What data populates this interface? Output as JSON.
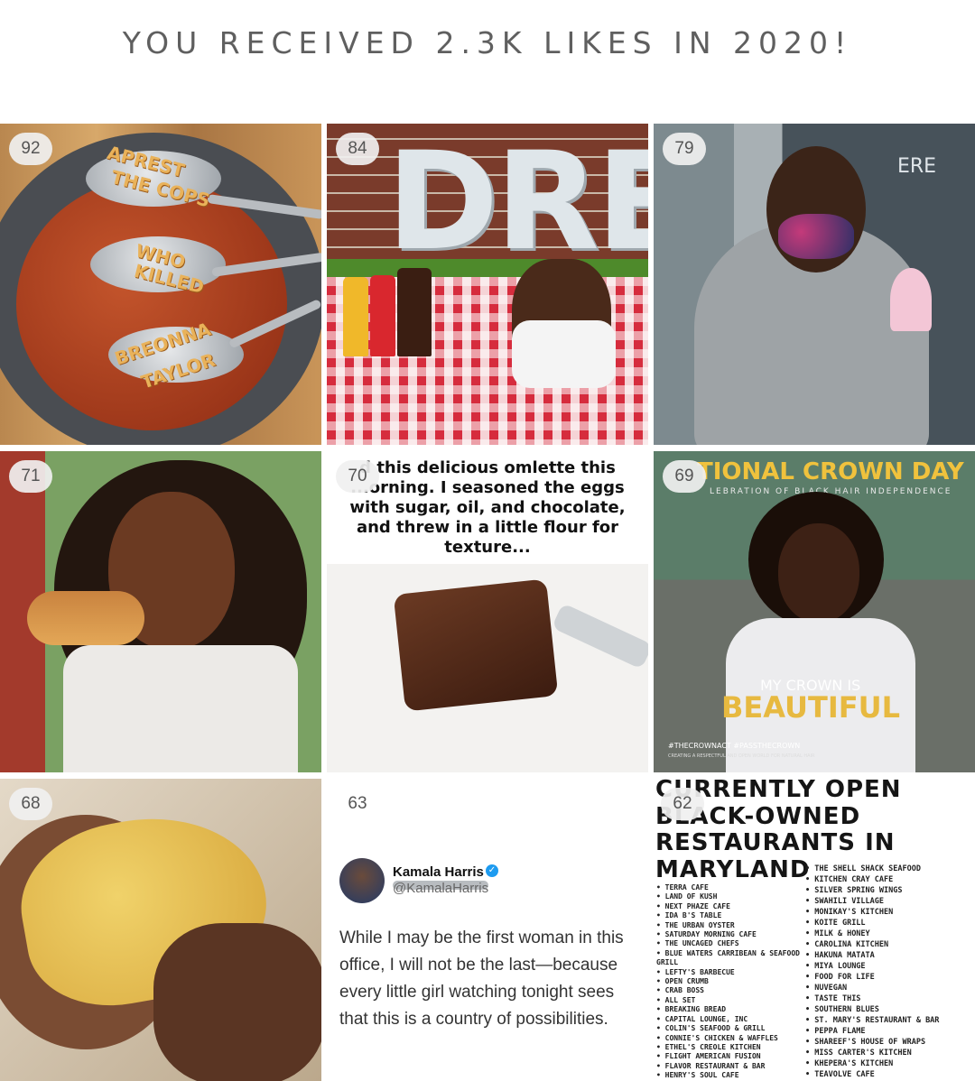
{
  "header": {
    "title": "YOU RECEIVED 2.3K LIKES IN 2020!"
  },
  "posts": [
    {
      "likes": "92",
      "overlay_text": [
        "APREST",
        "THE COPS",
        "WHO",
        "KILLED",
        "BREONNA",
        "TAYLOR"
      ]
    },
    {
      "likes": "84",
      "overlay_text": "DRE"
    },
    {
      "likes": "79",
      "overlay_text": "ERE"
    },
    {
      "likes": "71"
    },
    {
      "likes": "70",
      "caption": "d this delicious omlette this ...orning. I seasoned the eggs with sugar, oil, and chocolate, and threw in a little flour for texture..."
    },
    {
      "likes": "69",
      "banner": "TIONAL CROWN DAY",
      "sub": "LEBRATION OF BLACK HAIR INDEPENDENCE",
      "crown_line1": "MY CROWN IS",
      "crown_line2": "BEAUTIFUL",
      "hashtags": "#THECROWNACT #PASSTHECROWN",
      "footer": "CREATING A RESPECTFUL AND OPEN WORLD FOR NATURAL HAIR"
    },
    {
      "likes": "68"
    },
    {
      "likes": "63",
      "tweet": {
        "name": "Kamala Harris",
        "handle": "@KamalaHarris",
        "text": "While I may be the first woman in this office, I will not be the last—because every little girl watching tonight sees that this is a country of possibilities."
      }
    },
    {
      "likes": "62",
      "title": [
        "CURRENTLY OPEN",
        "BLACK-OWNED",
        "RESTAURANTS IN",
        "MARYLAND"
      ],
      "list_left": [
        "TERRA CAFE",
        "LAND OF KUSH",
        "NEXT PHAZE CAFE",
        "IDA B'S TABLE",
        "THE URBAN OYSTER",
        "SATURDAY MORNING CAFE",
        "THE UNCAGED CHEFS",
        "BLUE WATERS CARRIBEAN & SEAFOOD GRILL",
        "LEFTY'S BARBECUE",
        "OPEN CRUMB",
        "CRAB BOSS",
        "ALL SET",
        "BREAKING BREAD",
        "CAPITAL LOUNGE, INC",
        "COLIN'S SEAFOOD & GRILL",
        "CONNIE'S CHICKEN & WAFFLES",
        "ETHEL'S CREOLE KITCHEN",
        "FLIGHT AMERICAN FUSION",
        "FLAVOR RESTAURANT & BAR",
        "HENRY'S SOUL CAFE"
      ],
      "list_right": [
        "THE SHELL SHACK SEAFOOD",
        "KITCHEN CRAY CAFE",
        "SILVER SPRING WINGS",
        "SWAHILI VILLAGE",
        "MONIKAY'S KITCHEN",
        "KOITE GRILL",
        "MILK & HONEY",
        "CAROLINA KITCHEN",
        "HAKUNA MATATA",
        "MIYA LOUNGE",
        "FOOD FOR LIFE",
        "NUVEGAN",
        "TASTE THIS",
        "SOUTHERN BLUES",
        "ST. MARY'S RESTAURANT & BAR",
        "PEPPA FLAME",
        "SHAREEF'S HOUSE OF WRAPS",
        "MISS CARTER'S KITCHEN",
        "KHEPERA'S KITCHEN",
        "TEAVOLVE CAFE"
      ]
    }
  ]
}
